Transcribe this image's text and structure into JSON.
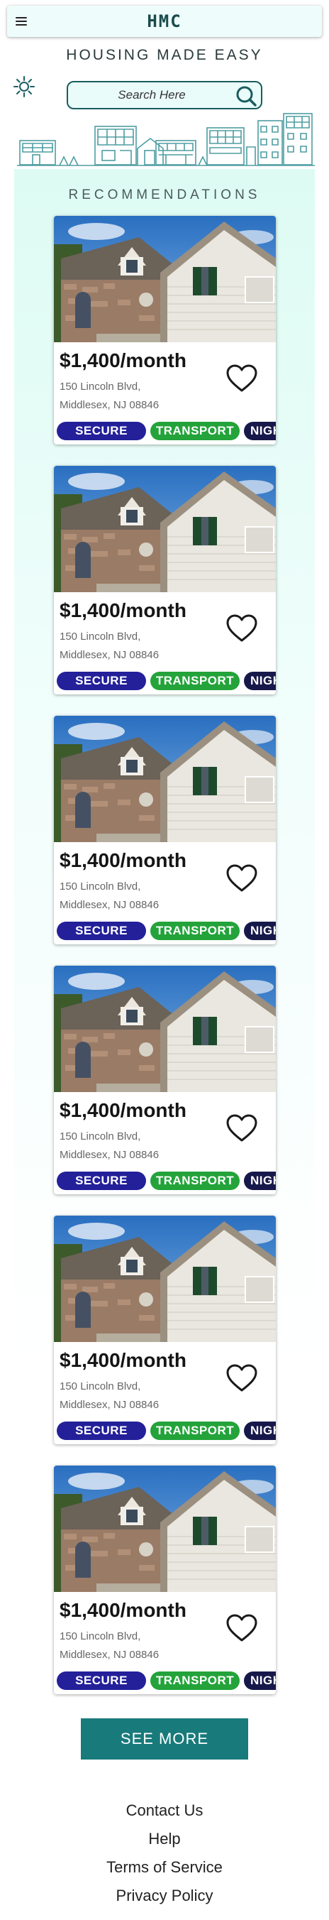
{
  "header": {
    "logo": "HMC",
    "menu_icon": "hamburger-menu-icon"
  },
  "hero": {
    "tagline": "HOUSING MADE EASY",
    "search_placeholder": "Search Here",
    "search_icon": "search-icon",
    "weather_icon": "sun-icon"
  },
  "recommendations": {
    "title": "RECOMMENDATIONS",
    "listings": [
      {
        "price": "$1,400/month",
        "address_line1": "150 Lincoln Blvd,",
        "address_line2": "Middlesex, NJ 08846",
        "tags": [
          "SECURE",
          "TRANSPORT",
          "NIGHTLIFE"
        ]
      },
      {
        "price": "$1,400/month",
        "address_line1": "150 Lincoln Blvd,",
        "address_line2": "Middlesex, NJ 08846",
        "tags": [
          "SECURE",
          "TRANSPORT",
          "NIGHTLIFE"
        ]
      },
      {
        "price": "$1,400/month",
        "address_line1": "150 Lincoln Blvd,",
        "address_line2": "Middlesex, NJ 08846",
        "tags": [
          "SECURE",
          "TRANSPORT",
          "NIGHTLIFE"
        ]
      },
      {
        "price": "$1,400/month",
        "address_line1": "150 Lincoln Blvd,",
        "address_line2": "Middlesex, NJ 08846",
        "tags": [
          "SECURE",
          "TRANSPORT",
          "NIGHTLIFE"
        ]
      },
      {
        "price": "$1,400/month",
        "address_line1": "150 Lincoln Blvd,",
        "address_line2": "Middlesex, NJ 08846",
        "tags": [
          "SECURE",
          "TRANSPORT",
          "NIGHTLIFE"
        ]
      },
      {
        "price": "$1,400/month",
        "address_line1": "150 Lincoln Blvd,",
        "address_line2": "Middlesex, NJ 08846",
        "tags": [
          "SECURE",
          "TRANSPORT",
          "NIGHTLIFE"
        ]
      }
    ],
    "see_more_label": "SEE MORE"
  },
  "footer": {
    "links": [
      "Contact Us",
      "Help",
      "Terms of Service",
      "Privacy Policy"
    ]
  },
  "colors": {
    "brand_teal": "#187a7b",
    "tag_secure": "#23209a",
    "tag_transport": "#23a33a",
    "tag_night": "#17184a",
    "header_bg": "#eefdfb"
  }
}
